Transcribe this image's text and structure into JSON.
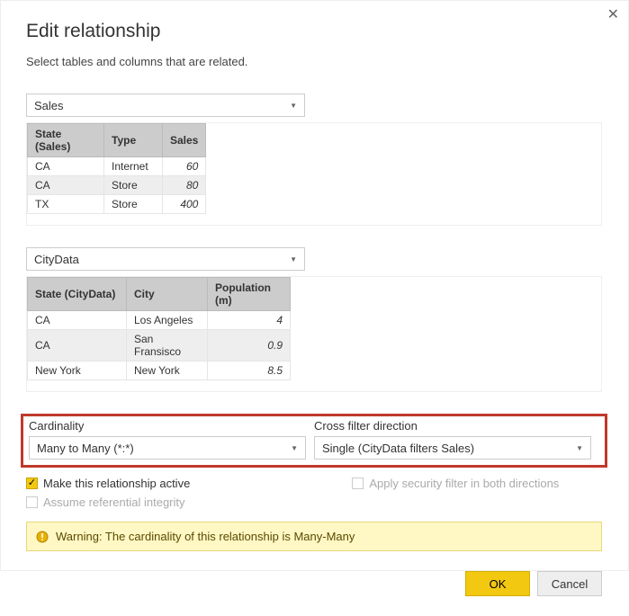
{
  "dialog": {
    "title": "Edit relationship",
    "subtitle": "Select tables and columns that are related."
  },
  "table1": {
    "selected": "Sales",
    "columns": [
      "State (Sales)",
      "Type",
      "Sales"
    ],
    "rows": [
      {
        "state": "CA",
        "type": "Internet",
        "sales": "60"
      },
      {
        "state": "CA",
        "type": "Store",
        "sales": "80"
      },
      {
        "state": "TX",
        "type": "Store",
        "sales": "400"
      }
    ]
  },
  "table2": {
    "selected": "CityData",
    "columns": [
      "State (CityData)",
      "City",
      "Population (m)"
    ],
    "rows": [
      {
        "state": "CA",
        "city": "Los Angeles",
        "pop": "4"
      },
      {
        "state": "CA",
        "city": "San Fransisco",
        "pop": "0.9"
      },
      {
        "state": "New York",
        "city": "New York",
        "pop": "8.5"
      }
    ]
  },
  "options": {
    "cardinality_label": "Cardinality",
    "cardinality_value": "Many to Many (*:*)",
    "crossfilter_label": "Cross filter direction",
    "crossfilter_value": "Single (CityData filters Sales)"
  },
  "checks": {
    "active_label": "Make this relationship active",
    "active_checked": true,
    "security_label": "Apply security filter in both directions",
    "security_checked": false,
    "referential_label": "Assume referential integrity",
    "referential_checked": false
  },
  "warning": {
    "text": "Warning: The cardinality of this relationship is Many-Many"
  },
  "buttons": {
    "ok": "OK",
    "cancel": "Cancel"
  }
}
